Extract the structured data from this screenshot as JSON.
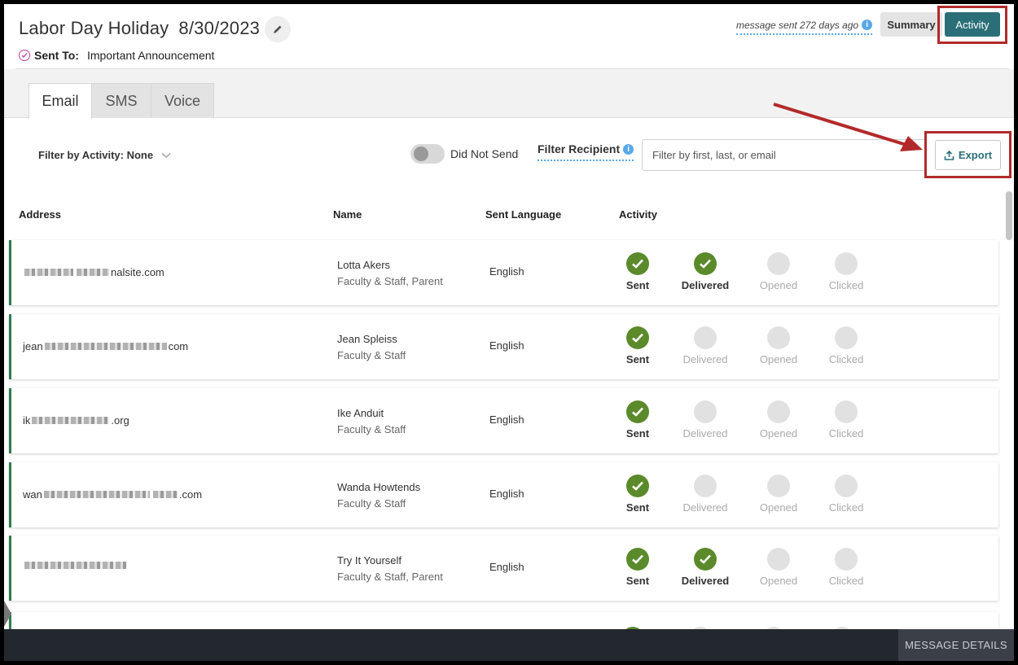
{
  "header": {
    "title": "Labor Day Holiday",
    "date": "8/30/2023",
    "sent_to_label": "Sent To:",
    "sent_to_value": "Important Announcement",
    "message_sent": "message sent 272 days ago",
    "summary_label": "Summary",
    "activity_label": "Activity"
  },
  "tabs": [
    {
      "label": "Email",
      "active": true
    },
    {
      "label": "SMS",
      "active": false
    },
    {
      "label": "Voice",
      "active": false
    }
  ],
  "filters": {
    "activity_label": "Filter by Activity: None",
    "did_not_send_label": "Did Not Send",
    "did_not_send_on": false,
    "recipient_label": "Filter Recipient",
    "search_placeholder": "Filter by first, last, or email",
    "export_label": "Export"
  },
  "table": {
    "columns": [
      "Address",
      "Name",
      "Sent Language",
      "Activity"
    ],
    "status_labels": [
      "Sent",
      "Delivered",
      "Opened",
      "Clicked"
    ],
    "rows": [
      {
        "addr_prefix": "",
        "addr_suffix": "nalsite.com",
        "name": "Lotta Akers",
        "groups": "Faculty & Staff, Parent",
        "language": "English",
        "status": [
          true,
          true,
          false,
          false
        ]
      },
      {
        "addr_prefix": "jean",
        "addr_suffix": "com",
        "name": "Jean Spleiss",
        "groups": "Faculty & Staff",
        "language": "English",
        "status": [
          true,
          false,
          false,
          false
        ]
      },
      {
        "addr_prefix": "ik",
        "addr_suffix": ".org",
        "name": "Ike Anduit",
        "groups": "Faculty & Staff",
        "language": "English",
        "status": [
          true,
          false,
          false,
          false
        ]
      },
      {
        "addr_prefix": "wan",
        "addr_suffix": ".com",
        "name": "Wanda Howtends",
        "groups": "Faculty & Staff",
        "language": "English",
        "status": [
          true,
          false,
          false,
          false
        ]
      },
      {
        "addr_prefix": "",
        "addr_suffix": "",
        "name": "Try It Yourself",
        "groups": "Faculty & Staff, Parent",
        "language": "English",
        "status": [
          true,
          true,
          false,
          false
        ]
      }
    ]
  },
  "footer": {
    "message_details_label": "MESSAGE DETAILS"
  },
  "colors": {
    "accent": "#2a6f78",
    "success": "#5b8a2b",
    "annotation": "#b22a2a",
    "info": "#5aa9e6"
  },
  "icons": {
    "edit": "pencil-icon",
    "sent_to": "check-circle-icon",
    "info": "info-icon",
    "export": "upload-icon",
    "dropdown": "chevron-down-icon",
    "status": "checkmark-icon"
  }
}
